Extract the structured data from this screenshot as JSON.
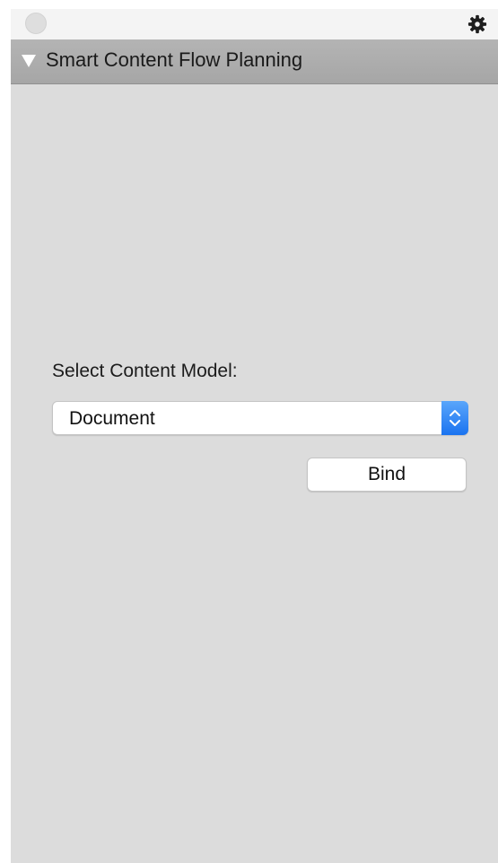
{
  "header": {
    "title": "Smart Content Flow Planning",
    "disclosure_icon": "triangle-down-icon",
    "settings_icon": "gear-icon"
  },
  "form": {
    "label": "Select Content Model:",
    "selected_model": "Document",
    "bind_label": "Bind"
  },
  "colors": {
    "panel_background": "#dcdcdc",
    "header_background": "#aaaaaa",
    "select_accent": "#1a73f0"
  }
}
